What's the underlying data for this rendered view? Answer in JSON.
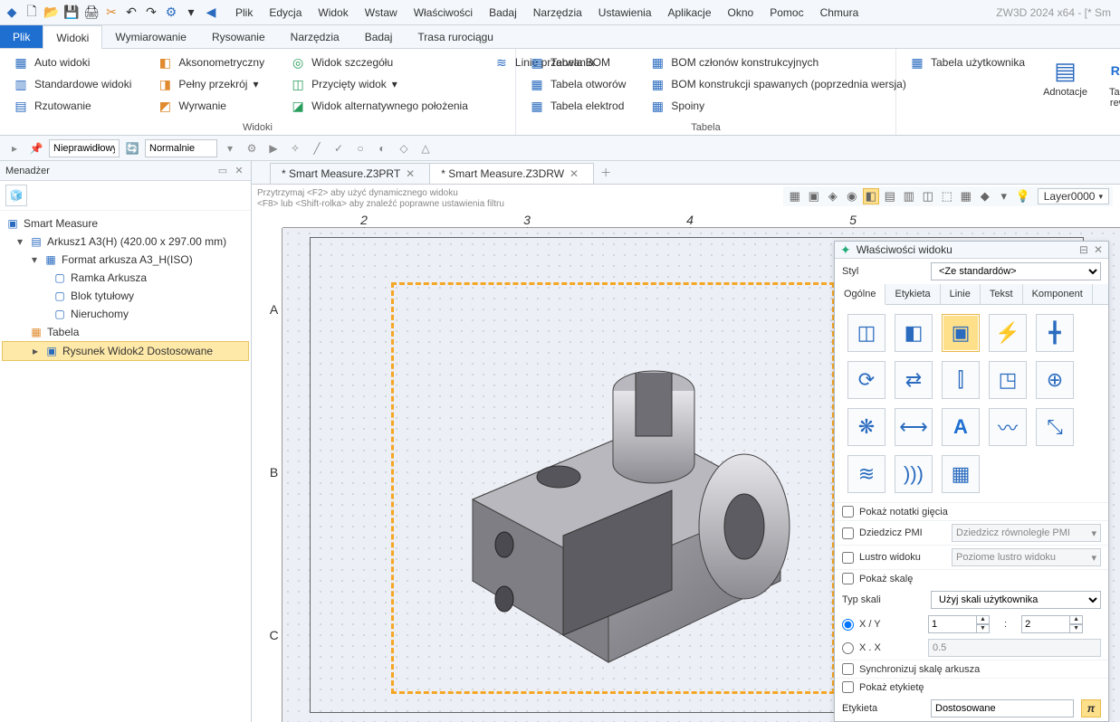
{
  "app": {
    "title_right": "ZW3D 2024 x64 - [* Sm"
  },
  "menus": [
    "Plik",
    "Edycja",
    "Widok",
    "Wstaw",
    "Właściwości",
    "Badaj",
    "Narzędzia",
    "Ustawienia",
    "Aplikacje",
    "Okno",
    "Pomoc",
    "Chmura"
  ],
  "ribbon_tabs": {
    "primary": "Plik",
    "items": [
      "Widoki",
      "Wymiarowanie",
      "Rysowanie",
      "Narzędzia",
      "Badaj",
      "Trasa rurociągu"
    ],
    "active": "Widoki"
  },
  "ribbon": {
    "group_views": {
      "label": "Widoki",
      "col1": [
        "Auto widoki",
        "Standardowe widoki",
        "Rzutowanie"
      ],
      "col2": [
        "Aksonometryczny",
        "Pełny przekrój",
        "Wyrwanie"
      ],
      "col3": [
        "Widok szczegółu",
        "Przycięty widok",
        "Widok alternatywnego położenia"
      ],
      "break": "Linie przerwania"
    },
    "group_tables": {
      "label": "Tabela",
      "col1": [
        "Tabela BOM",
        "Tabela otworów",
        "Tabela elektrod"
      ],
      "col2": [
        "BOM członów konstrukcyjnych",
        "BOM konstrukcji spawanych (poprzednia wersja)",
        "Spoiny"
      ],
      "user_table": "Tabela użytkownika"
    },
    "big1": "Adnotacje",
    "big2": "Tabela rewizji"
  },
  "toolbar2": {
    "filter": "Nieprawidłowy",
    "mode": "Normalnie"
  },
  "tree": {
    "header": "Menadżer",
    "root": "Smart Measure",
    "sheet": "Arkusz1 A3(H) (420.00 x 297.00 mm)",
    "format": "Format arkusza A3_H(ISO)",
    "children": [
      "Ramka Arkusza",
      "Blok tytułowy",
      "Nieruchomy"
    ],
    "extra": "Tabela",
    "selected": "Rysunek Widok2 Dostosowane"
  },
  "doc_tabs": {
    "tab1": "* Smart Measure.Z3PRT",
    "tab2": "* Smart Measure.Z3DRW"
  },
  "hints": {
    "l1": "Przytrzymaj <F2> aby użyć dynamicznego widoku",
    "l2": "<F8> lub <Shift-rolka> aby znaleźć poprawne ustawienia filtru"
  },
  "ruler_h": [
    "2",
    "3",
    "4",
    "5"
  ],
  "ruler_v": [
    "A",
    "B",
    "C"
  ],
  "layer": "Layer0000",
  "props": {
    "title": "Właściwości widoku",
    "style_label": "Styl",
    "style_value": "<Ze standardów>",
    "tabs": [
      "Ogólne",
      "Etykieta",
      "Linie",
      "Tekst",
      "Komponent"
    ],
    "chk_bend": "Pokaż notatki gięcia",
    "pmi_label": "Dziedzicz PMI",
    "pmi_value": "Dziedzicz równoległe PMI",
    "mirror_label": "Lustro widoku",
    "mirror_value": "Poziome lustro widoku",
    "show_scale": "Pokaż skalę",
    "scale_type_label": "Typ skali",
    "scale_type_value": "Użyj skali użytkownika",
    "xy_label": "X / Y",
    "xx_label": "X . X",
    "xy_val1": "1",
    "xy_sep": ":",
    "xy_val2": "2",
    "xx_val": "0.5",
    "sync": "Synchronizuj skalę arkusza",
    "show_label": "Pokaż etykietę",
    "label_label": "Etykieta",
    "label_value": "Dostosowane"
  }
}
